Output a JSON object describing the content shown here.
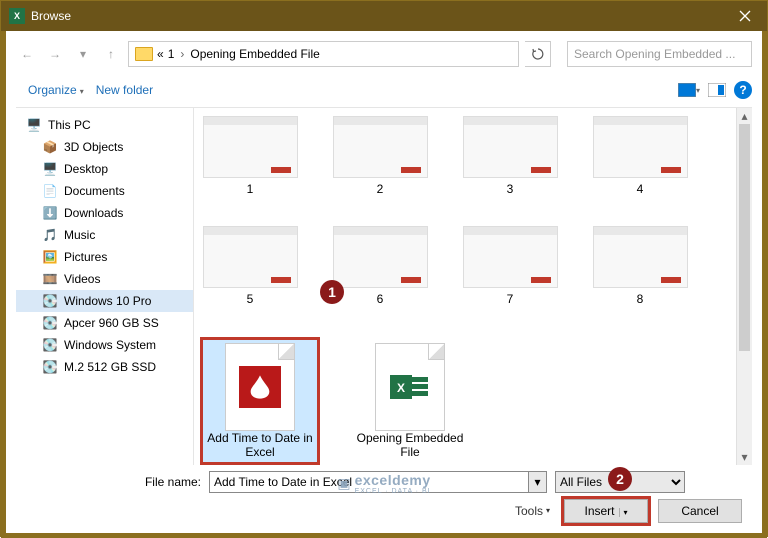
{
  "titlebar": {
    "title": "Browse"
  },
  "nav": {
    "crumb_prefix": "«",
    "crumb1": "1",
    "crumb2": "Opening Embedded File",
    "search_placeholder": "Search Opening Embedded ..."
  },
  "toolbar": {
    "organize": "Organize",
    "newfolder": "New folder"
  },
  "tree": {
    "thispc": "This PC",
    "objects3d": "3D Objects",
    "desktop": "Desktop",
    "documents": "Documents",
    "downloads": "Downloads",
    "music": "Music",
    "pictures": "Pictures",
    "videos": "Videos",
    "win10": "Windows 10 Pro",
    "apacer": "Apcer 960 GB SS",
    "winsys": "Windows System",
    "m2": "M.2 512 GB SSD"
  },
  "thumbs": {
    "t1": "1",
    "t2": "2",
    "t3": "3",
    "t4": "4",
    "t5": "5",
    "t6": "6",
    "t7": "7",
    "t8": "8"
  },
  "files": {
    "pdf": "Add Time to Date in Excel",
    "xlsx": "Opening Embedded File"
  },
  "callouts": {
    "c1": "1",
    "c2": "2"
  },
  "footer": {
    "filename_label": "File name:",
    "filename_value": "Add Time to Date in Excel",
    "filter": "All Files",
    "tools": "Tools",
    "insert": "Insert",
    "cancel": "Cancel"
  },
  "watermark": {
    "brand": "exceldemy",
    "sub": "EXCEL · DATA · BI"
  }
}
